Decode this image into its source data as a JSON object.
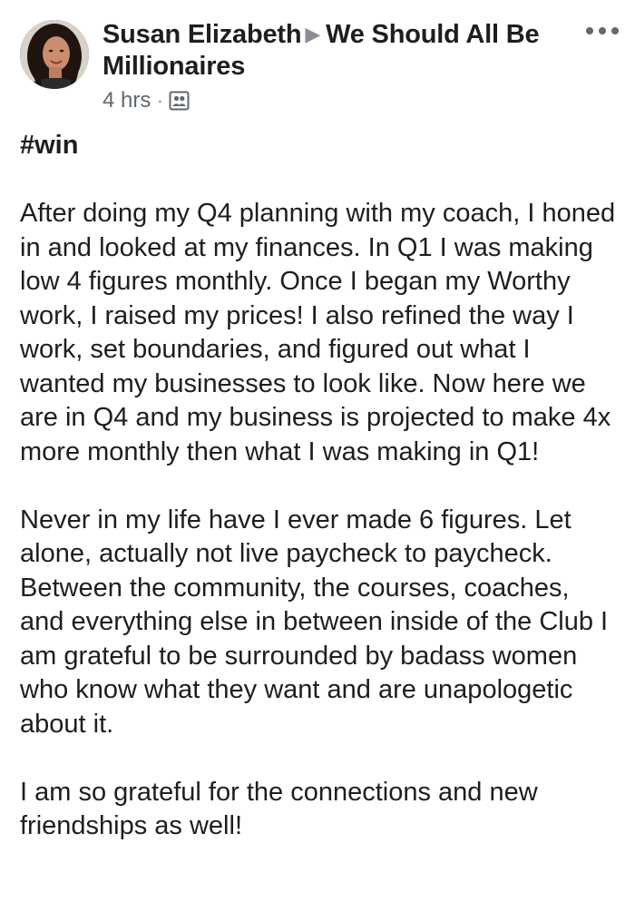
{
  "post": {
    "author": "Susan Elizabeth",
    "group": "We Should All Be Millionaires",
    "group_line2": "Millionaires",
    "group_line1": "We Should All Be",
    "time": "4 hrs",
    "separator": "·",
    "audience_icon": "group-icon",
    "more_icon": "more-options-icon",
    "hashtag": "#win",
    "paragraphs": [
      "After doing my Q4 planning with my coach, I honed in and looked at my finances. In Q1 I was making low 4 figures monthly. Once I began my Worthy work, I raised my prices! I also refined the way I work, set boundaries, and figured out what I wanted my businesses to look like. Now here we are in Q4 and my business is projected to make 4x more monthly then what I was making in Q1!",
      "Never in my life have I ever made 6 figures. Let alone, actually not live paycheck to paycheck. Between the community, the courses, coaches, and everything else in between inside of the Club I am grateful to be surrounded by badass women who know what they want and are unapologetic about it.",
      "I am so grateful for the connections and new friendships as well!"
    ]
  }
}
